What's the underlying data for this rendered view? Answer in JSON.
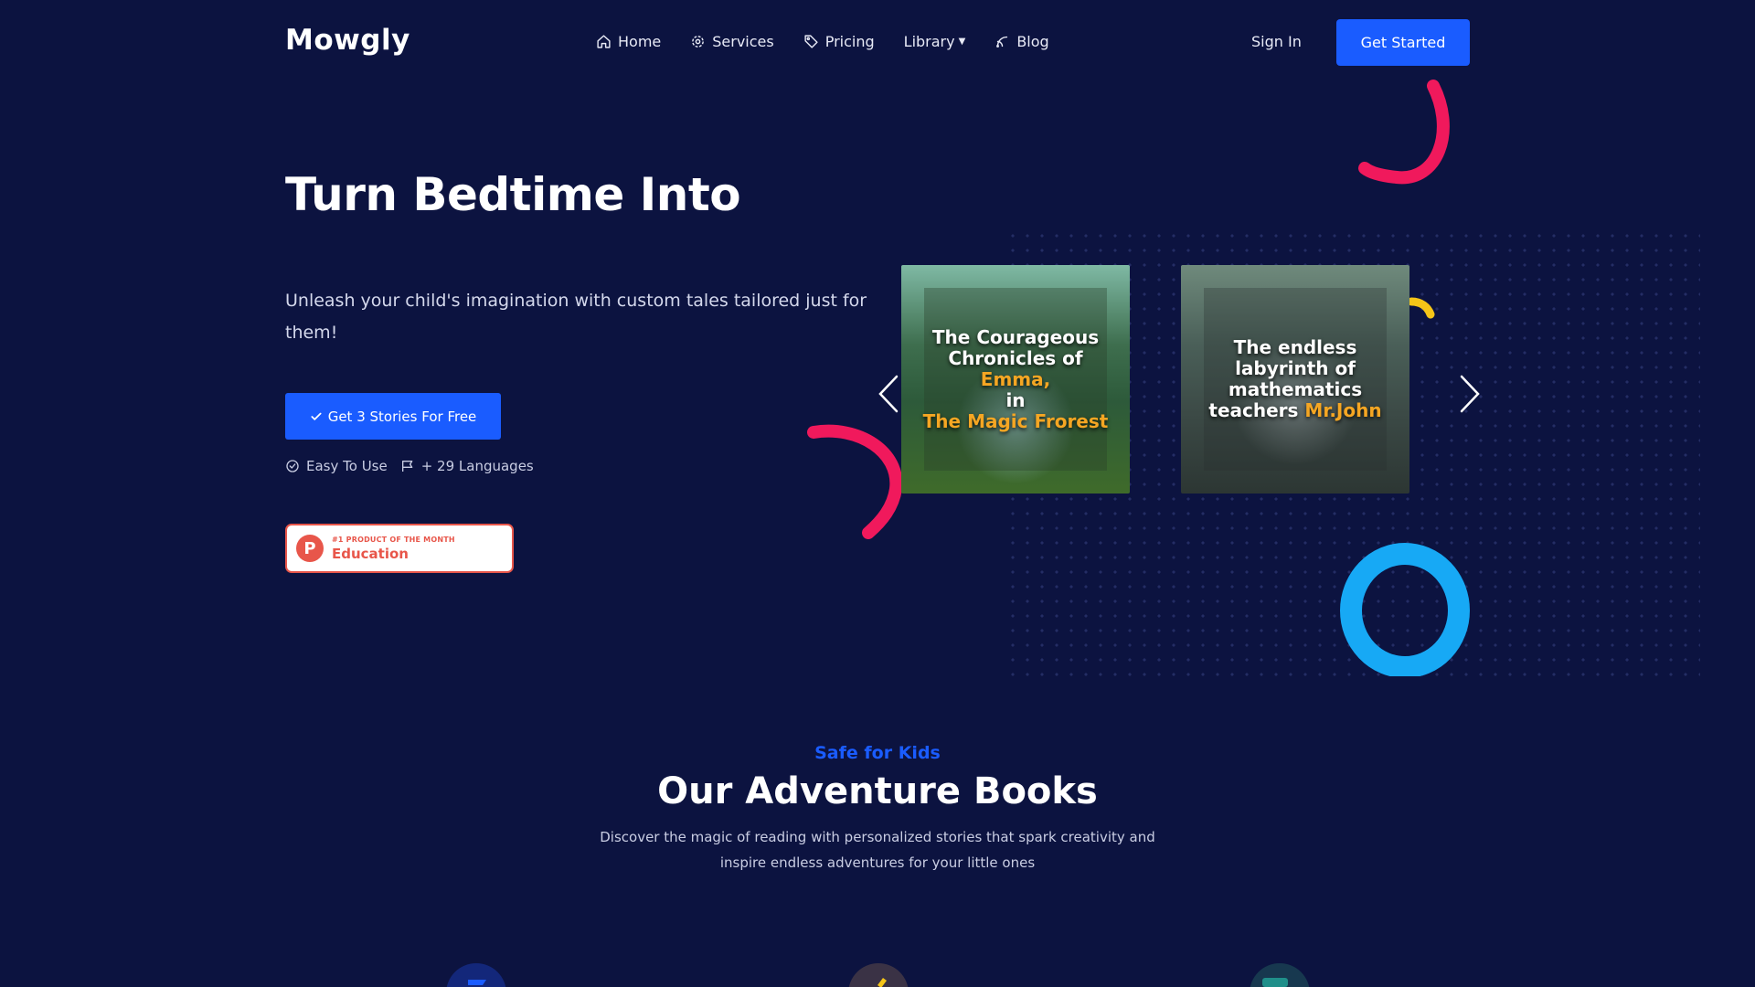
{
  "brand": {
    "name": "Mowgly"
  },
  "nav": {
    "items": [
      {
        "label": "Home",
        "icon": "home-icon"
      },
      {
        "label": "Services",
        "icon": "gear-icon"
      },
      {
        "label": "Pricing",
        "icon": "tag-icon"
      },
      {
        "label": "Library",
        "icon": "chevron-down-icon"
      },
      {
        "label": "Blog",
        "icon": "blog-icon"
      }
    ],
    "signin_label": "Sign In",
    "get_started_label": "Get Started"
  },
  "hero": {
    "title": "Turn Bedtime Into",
    "subtitle": "Unleash your child's imagination with custom tales tailored just for them!",
    "cta_label": "Get 3 Stories For Free",
    "features": [
      {
        "label": "Easy To Use",
        "icon": "check-circle-icon"
      },
      {
        "label": "+ 29 Languages",
        "icon": "flag-icon"
      }
    ],
    "badge": {
      "logo_letter": "P",
      "top": "#1 PRODUCT OF THE MONTH",
      "main": "Education"
    }
  },
  "carousel": {
    "books": [
      {
        "lines": [
          "The Courageous",
          "Chronicles of"
        ],
        "highlight1": "Emma,",
        "mid": "in",
        "highlight2": "The Magic Frorest"
      },
      {
        "lines": [
          "The endless",
          "labyrinth of",
          "mathematics"
        ],
        "prefix": "teachers ",
        "highlight": "Mr.John"
      }
    ]
  },
  "section": {
    "kicker": "Safe for Kids",
    "title": "Our Adventure Books",
    "description": "Discover the magic of reading with personalized stories that spark creativity and inspire endless adventures for your little ones"
  },
  "colors": {
    "background": "#0c1340",
    "accent": "#1a5cff",
    "pink": "#f0195c",
    "cyan": "#17a9f5",
    "yellow": "#f5c518",
    "badge": "#e8564a"
  }
}
